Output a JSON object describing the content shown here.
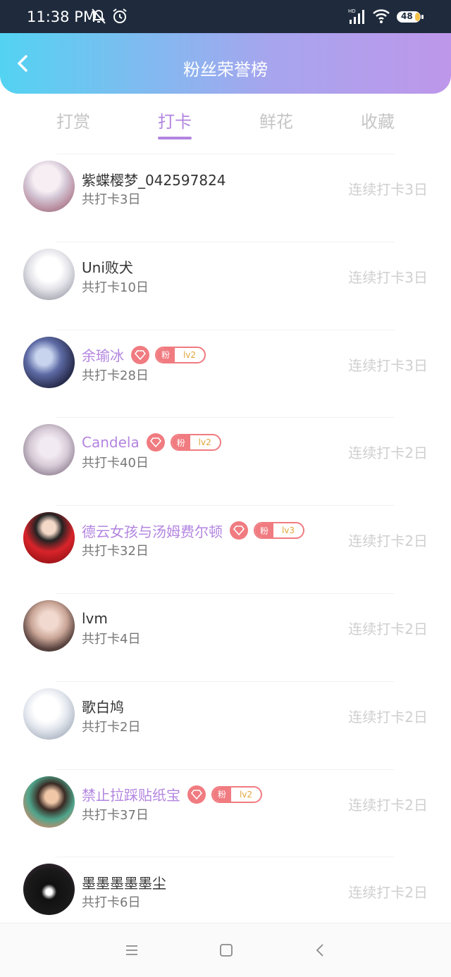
{
  "status_bar": {
    "time": "11:38 PM",
    "battery": "48"
  },
  "header": {
    "title": "粉丝荣誉榜"
  },
  "tabs": [
    {
      "label": "打赏",
      "active": false
    },
    {
      "label": "打卡",
      "active": true
    },
    {
      "label": "鲜花",
      "active": false
    },
    {
      "label": "收藏",
      "active": false
    }
  ],
  "colors": {
    "accent": "#b385e0",
    "badge": "#f07b80",
    "header_start": "#53d3f2",
    "header_end": "#be97ea"
  },
  "rows": [
    {
      "name": "紫蝶樱梦_042597824",
      "total": "共打卡3日",
      "streak": "连续打卡3日",
      "vip": false
    },
    {
      "name": "Uni败犬",
      "total": "共打卡10日",
      "streak": "连续打卡3日",
      "vip": false
    },
    {
      "name": "余瑜冰",
      "total": "共打卡28日",
      "streak": "连续打卡3日",
      "vip": true,
      "fan": "粉",
      "level": "lv2"
    },
    {
      "name": "Candela",
      "total": "共打卡40日",
      "streak": "连续打卡2日",
      "vip": true,
      "fan": "粉",
      "level": "lv2"
    },
    {
      "name": "德云女孩与汤姆费尔顿",
      "total": "共打卡32日",
      "streak": "连续打卡2日",
      "vip": true,
      "fan": "粉",
      "level": "lv3"
    },
    {
      "name": "lvm",
      "total": "共打卡4日",
      "streak": "连续打卡2日",
      "vip": false
    },
    {
      "name": "歌白鸠",
      "total": "共打卡2日",
      "streak": "连续打卡2日",
      "vip": false
    },
    {
      "name": "禁止拉踩贴纸宝",
      "total": "共打卡37日",
      "streak": "连续打卡2日",
      "vip": true,
      "fan": "粉",
      "level": "lv2"
    },
    {
      "name": "墨墨墨墨墨尘",
      "total": "共打卡6日",
      "streak": "连续打卡2日",
      "vip": false
    }
  ],
  "nav_bar": {
    "items": [
      "menu-icon",
      "home-icon",
      "back-icon"
    ]
  }
}
